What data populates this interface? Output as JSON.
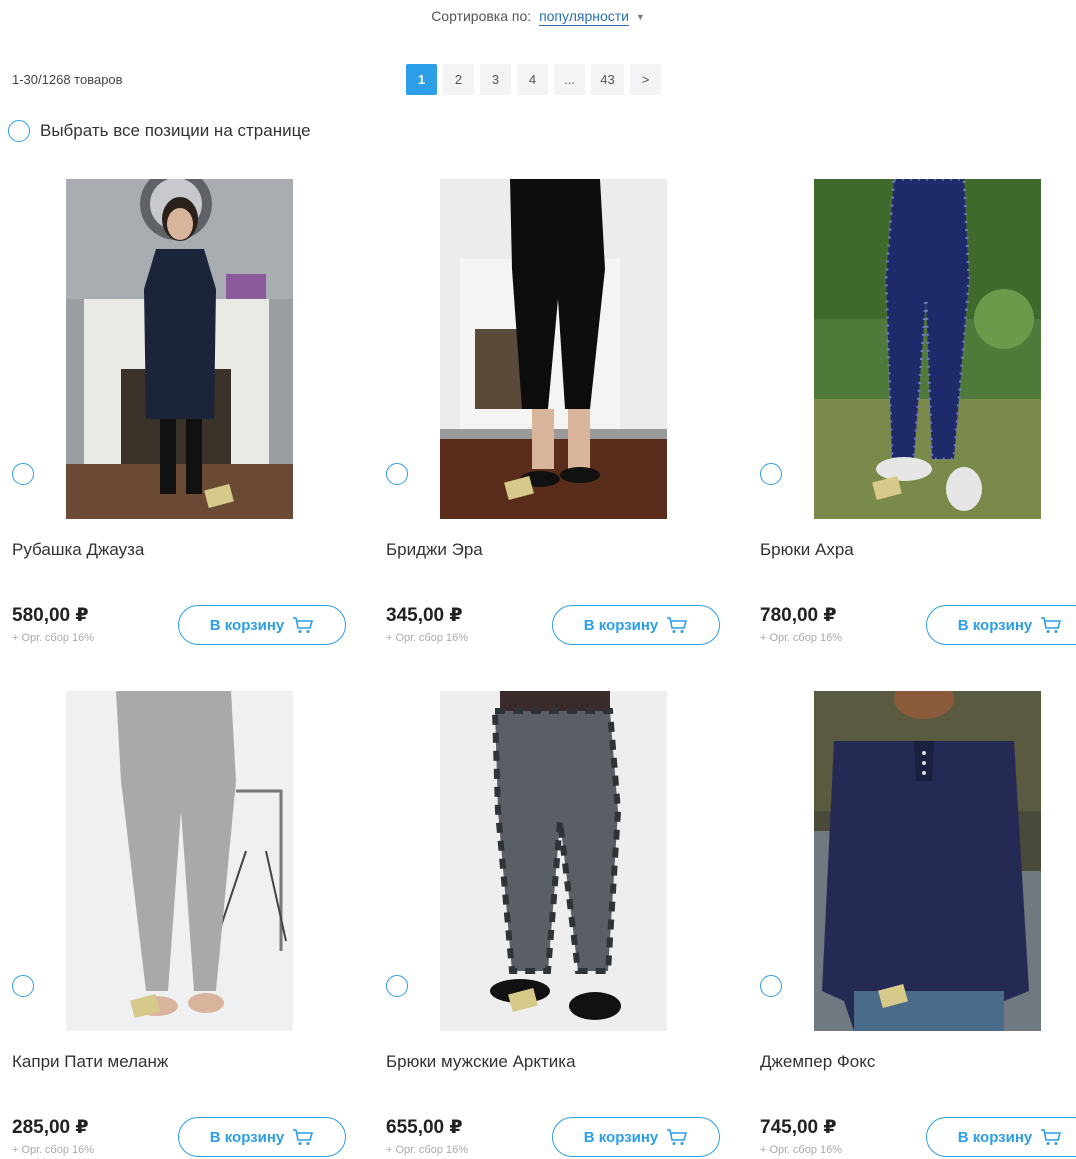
{
  "sort": {
    "label": "Сортировка по:",
    "value": "популярности"
  },
  "count": "1-30/1268 товаров",
  "pagination": [
    "1",
    "2",
    "3",
    "4",
    "...",
    "43",
    ">"
  ],
  "select_all": "Выбрать все позиции на странице",
  "cart_label": "В корзину",
  "products": [
    {
      "title": "Рубашка Джауза",
      "price": "580,00 ₽",
      "fee": "+ Орг. сбор 16%"
    },
    {
      "title": "Бриджи Эра",
      "price": "345,00 ₽",
      "fee": "+ Орг. сбор 16%"
    },
    {
      "title": "Брюки Ахра",
      "price": "780,00 ₽",
      "fee": "+ Орг. сбор 16%"
    },
    {
      "title": "Капри Пати меланж",
      "price": "285,00 ₽",
      "fee": "+ Орг. сбор 16%"
    },
    {
      "title": "Брюки мужские Арктика",
      "price": "655,00 ₽",
      "fee": "+ Орг. сбор 16%"
    },
    {
      "title": "Джемпер Фокс",
      "price": "745,00 ₽",
      "fee": "+ Орг. сбор 16%"
    }
  ],
  "colors": {
    "accent": "#2d9ee8",
    "link": "#2a6fb0"
  }
}
